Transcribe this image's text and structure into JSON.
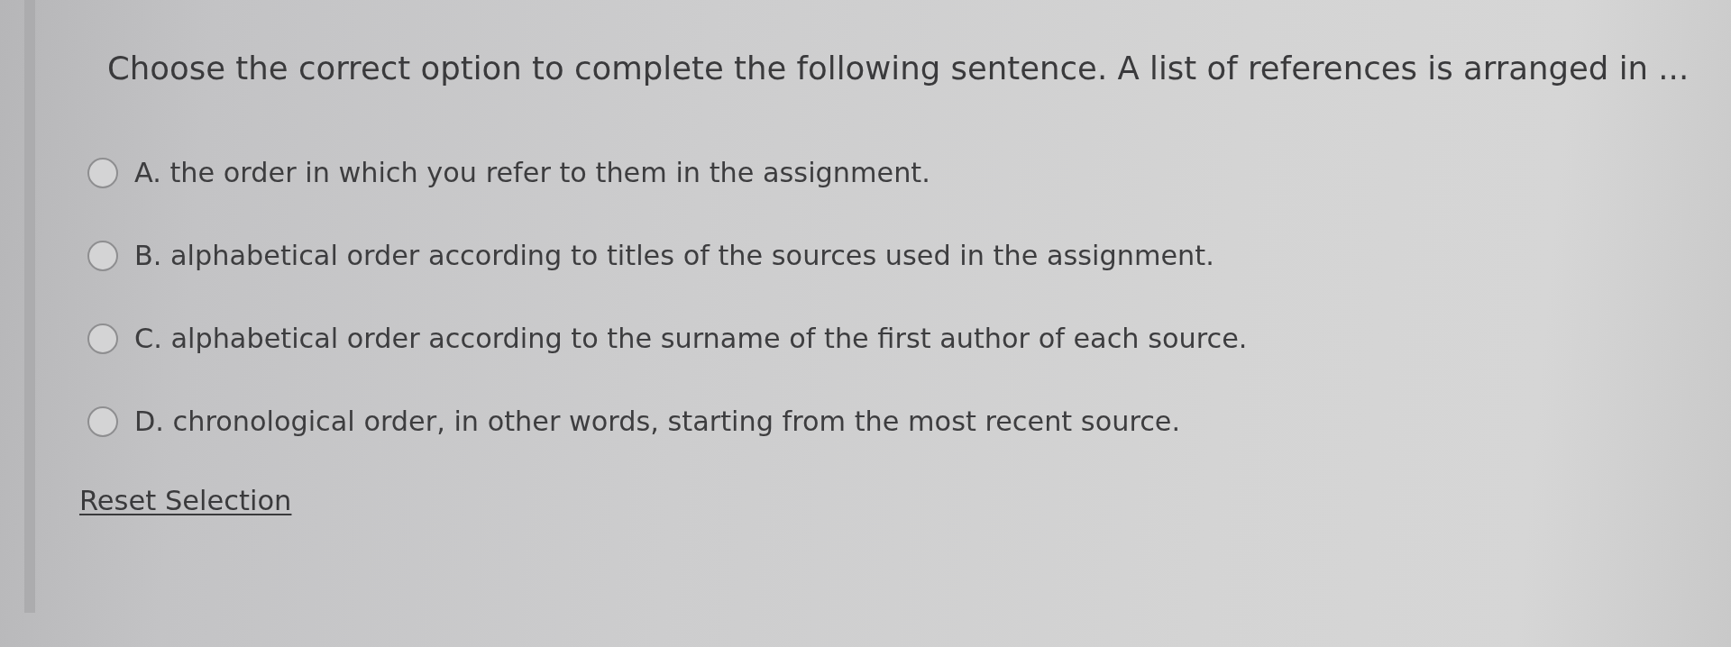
{
  "question": {
    "text": "Choose the correct option to complete the following sentence. A list of references is arranged in ..."
  },
  "options": [
    {
      "label": "A. the order in which you refer to them in the assignment.",
      "selected": false
    },
    {
      "label": "B. alphabetical order according to titles of the sources used in the assignment.",
      "selected": false
    },
    {
      "label": "C. alphabetical order according to the surname of the first author of each source.",
      "selected": false
    },
    {
      "label": "D. chronological order, in other words, starting from the most recent source.",
      "selected": false
    }
  ],
  "reset_link": {
    "label": "Reset Selection"
  }
}
